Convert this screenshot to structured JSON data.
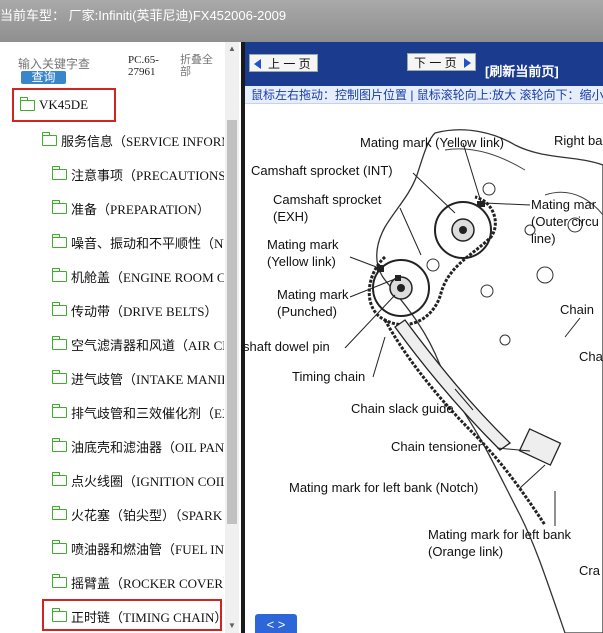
{
  "header": {
    "title": "当前车型： 厂家:Infiniti(英菲尼迪)FX452006-2009"
  },
  "sidebar": {
    "search_placeholder": "输入关键字查",
    "query_label": "查询",
    "pc_code": "PC.65-27961",
    "fold_all": "折叠全部",
    "root": "VK45DE",
    "service_info": "服务信息（SERVICE INFORMATION）",
    "items": [
      "注意事项（PRECAUTIONS）",
      "准备（PREPARATION）",
      "噪音、振动和不平顺性（NVH TROUBLESHOOTING）",
      "机舱盖（ENGINE ROOM COVER）",
      "传动带（DRIVE BELTS）",
      "空气滤清器和风道（AIR CLEANER AND AIR DUCT）",
      "进气歧管（INTAKE MANIFOLD）",
      "排气歧管和三效催化剂（EXHAUST MANIFOLD）",
      "油底壳和滤油器（OIL PAN AND OIL STRAINER）",
      "点火线圈（IGNITION COIL）",
      "火花塞（铂尖型）（SPARK PLUG）",
      "喷油器和燃油管（FUEL INJECTOR AND FUEL TUBE）",
      "摇臂盖（ROCKER COVER）",
      "正时链（TIMING CHAIN）"
    ]
  },
  "viewer": {
    "prev_label": "上 一 页",
    "next_label": "下 一 页",
    "refresh_label": "[刷新当前页]",
    "hint": "鼠标左右拖动：控制图片位置 | 鼠标滚轮向上:放大  滚轮向下：缩小",
    "expand_label": "< >",
    "labels": {
      "mating_yellow_top": "Mating mark (Yellow link)",
      "right_bank": "Right ba",
      "cam_int": "Camshaft sprocket (INT)",
      "cam_exh_1": "Camshaft sprocket",
      "cam_exh_2": "(EXH)",
      "mating_outer_1": "Mating mar",
      "mating_outer_2": "(Outer circu",
      "mating_outer_3": "line)",
      "mating_yellow_1": "Mating mark",
      "mating_yellow_2": "(Yellow link)",
      "mating_punch_1": "Mating mark",
      "mating_punch_2": "(Punched)",
      "chain_right": "Chain",
      "cha_right": "Cha",
      "dowel_pin": "shaft dowel pin",
      "timing_chain": "Timing chain",
      "slack_guide": "Chain slack guide",
      "tensioner": "Chain tensioner",
      "left_bank_notch": "Mating mark for left bank (Notch)",
      "left_bank_orange_1": "Mating mark for left bank",
      "left_bank_orange_2": "(Orange link)",
      "cra": "Cra"
    }
  }
}
